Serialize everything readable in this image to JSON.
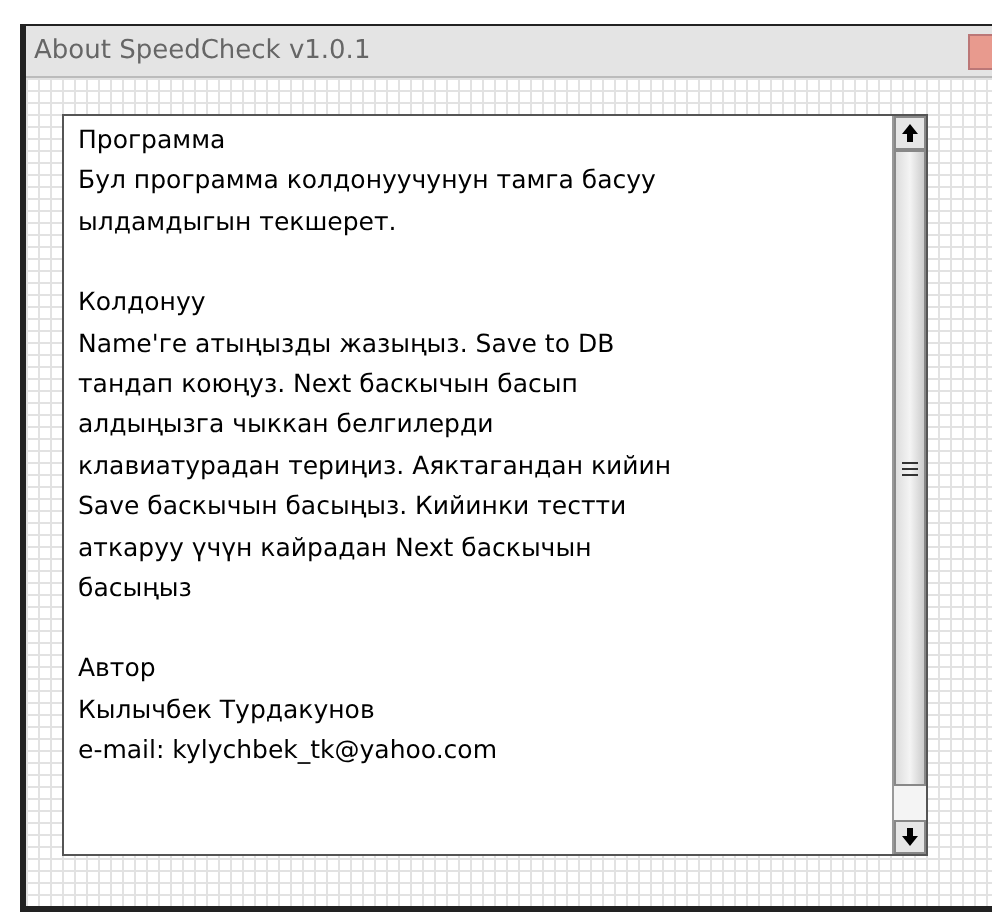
{
  "window": {
    "title": "About SpeedCheck v1.0.1"
  },
  "text_box": {
    "paragraphs": [
      {
        "lines": [
          "Программа",
          "Бул программа колдонуучунун тамга басуу",
          "ылдамдыгын текшерет."
        ]
      },
      {
        "lines": [
          "Колдонуу",
          "Name'ге атыңызды жазыңыз. Save to DB",
          "тандап коюңуз. Next баскычын басып",
          "алдыңызга чыккан белгилерди",
          "клавиатурадан териңиз. Аяктагандан кийин",
          "Save баскычын басыңыз. Кийинки тестти",
          "аткаруу үчүн кайрадан Next баскычын",
          "басыңыз"
        ]
      },
      {
        "lines": [
          "Автор",
          "Кылычбек Турдакунов",
          "e-mail: kylychbek_tk@yahoo.com"
        ]
      }
    ]
  }
}
